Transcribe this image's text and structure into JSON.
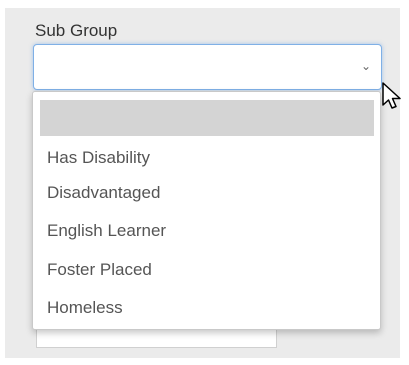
{
  "form": {
    "sub_group_label": "Sub Group",
    "sub_group_value": ""
  },
  "dropdown": {
    "options": [
      "",
      "Has Disability",
      "Disadvantaged",
      "English Learner",
      "Foster Placed",
      "Homeless"
    ],
    "highlighted_index": 0
  },
  "icons": {
    "select_arrow": "chevron-down-icon",
    "pointer": "mouse-pointer-icon"
  },
  "colors": {
    "focus_border": "#7fb0e6",
    "highlight": "#d4d4d4",
    "panel_background": "#ebebeb"
  }
}
